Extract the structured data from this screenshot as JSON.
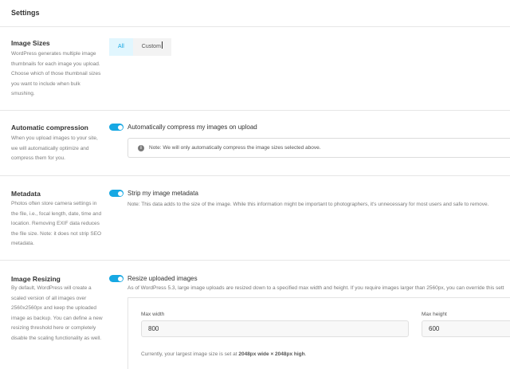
{
  "header": {
    "title": "Settings"
  },
  "image_sizes": {
    "title": "Image Sizes",
    "description": "WordPress generates multiple image thumbnails for each image you upload. Choose which of those thumbnail sizes you want to include when bulk smushing.",
    "tabs": [
      {
        "label": "All",
        "active": true
      },
      {
        "label": "Custom",
        "active": false
      }
    ]
  },
  "auto_compression": {
    "title": "Automatic compression",
    "description": "When you upload images to your site, we will automatically optimize and compress them for you.",
    "toggle_label": "Automatically compress my images on upload",
    "toggle_on": true,
    "notice": "Note: We will only automatically compress the image sizes selected above."
  },
  "metadata": {
    "title": "Metadata",
    "description": "Photos often store camera settings in the file, i.e., focal length, date, time and location. Removing EXIF data reduces the file size. Note: it does not strip SEO metadata.",
    "toggle_label": "Strip my image metadata",
    "toggle_on": true,
    "note": "Note: This data adds to the size of the image. While this information might be important to photographers, it's unnecessary for most users and safe to remove."
  },
  "image_resizing": {
    "title": "Image Resizing",
    "description": "By default, WordPress will create a scaled version of all images over 2560x2560px and keep the uploaded image as backup. You can define a new resizing threshold here or completely disable the scaling functionality as well.",
    "toggle_label": "Resize uploaded images",
    "toggle_on": true,
    "note": "As of WordPress 5.3, large image uploads are resized down to a specified max width and height. If you require images larger than 2560px, you can override this sett",
    "max_width_label": "Max width",
    "max_width_value": "800",
    "max_height_label": "Max height",
    "max_height_value": "600",
    "current_prefix": "Currently, your largest image size is set at ",
    "current_value": "2048px wide × 2048px high",
    "current_suffix": "."
  },
  "colors": {
    "accent": "#17a8e3",
    "tab_active_bg": "#e1f6fe"
  }
}
